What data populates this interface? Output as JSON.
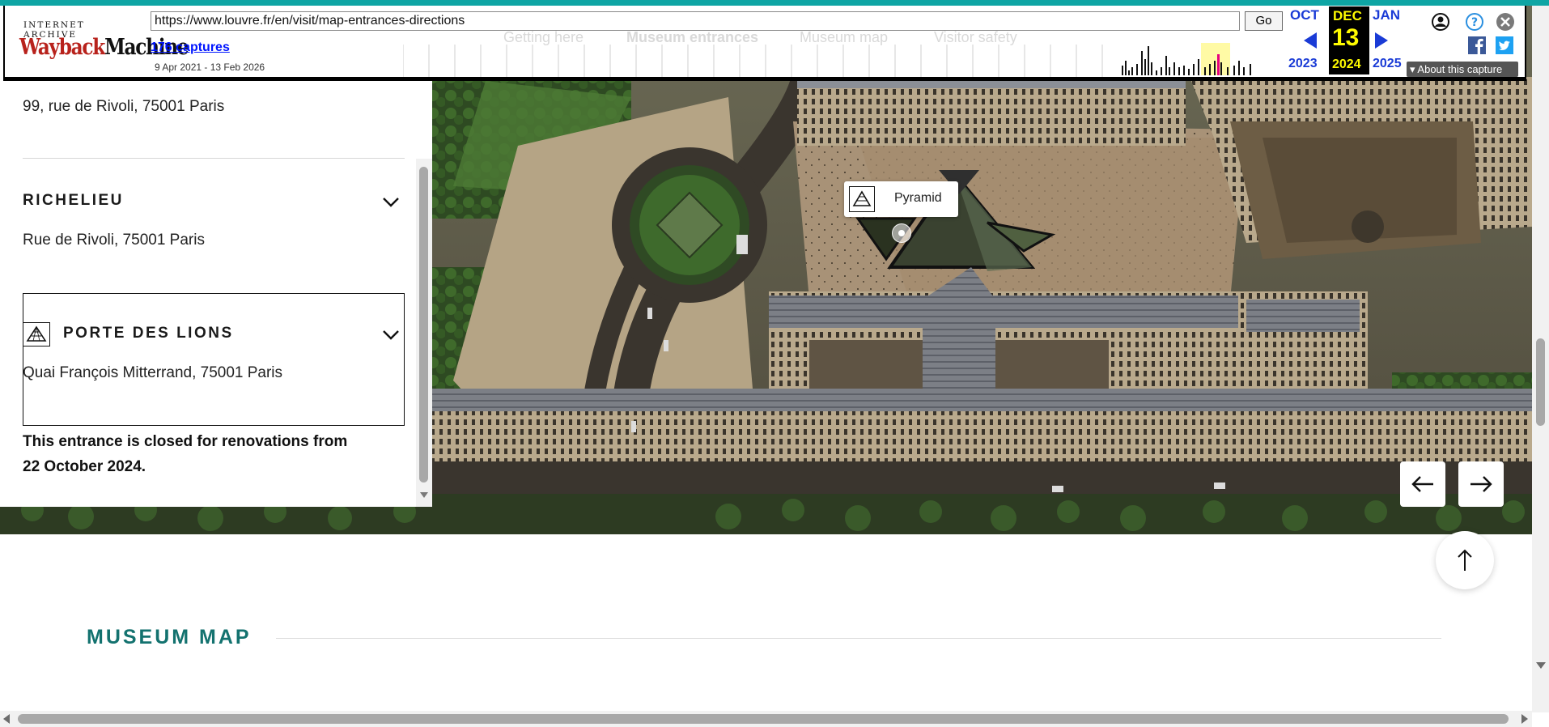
{
  "wayback": {
    "logo_top": "INTERNET ARCHIVE",
    "logo_main_a": "Wayback",
    "logo_main_b": "Machine",
    "url": "https://www.louvre.fr/en/visit/map-entrances-directions",
    "go_label": "Go",
    "captures": "176 captures",
    "date_range": "9 Apr 2021 - 13 Feb 2026",
    "prev_month": "OCT",
    "prev_year": "2023",
    "cur_month": "DEC",
    "cur_day": "13",
    "cur_year": "2024",
    "next_month": "JAN",
    "next_year": "2025",
    "about": "About this capture",
    "faded_tabs": [
      "Getting here",
      "Museum entrances",
      "Museum map",
      "Visitor safety"
    ]
  },
  "panel": {
    "addr_top": "99, rue de Rivoli, 75001 Paris",
    "richelieu_heading": "RICHELIEU",
    "richelieu_addr": "Rue de Rivoli, 75001 Paris",
    "lions_heading": "PORTE DES LIONS",
    "lions_addr": "Quai François Mitterrand, 75001 Paris",
    "notice": "This entrance is closed for renovations from 22 October 2024."
  },
  "map": {
    "pyramid_label": "Pyramid"
  },
  "museum_map": {
    "title": "MUSEUM MAP"
  },
  "colors": {
    "teal_accent": "#13726f",
    "wayback_strip": "#0ea5a4",
    "wayback_red": "#b8221c",
    "wayback_blue": "#0015ff"
  },
  "icons": [
    "pyramid-icon",
    "chevron-down-icon",
    "arrow-left-icon",
    "arrow-right-icon",
    "arrow-up-icon",
    "user-icon",
    "help-icon",
    "close-icon",
    "facebook-icon",
    "twitter-icon"
  ]
}
